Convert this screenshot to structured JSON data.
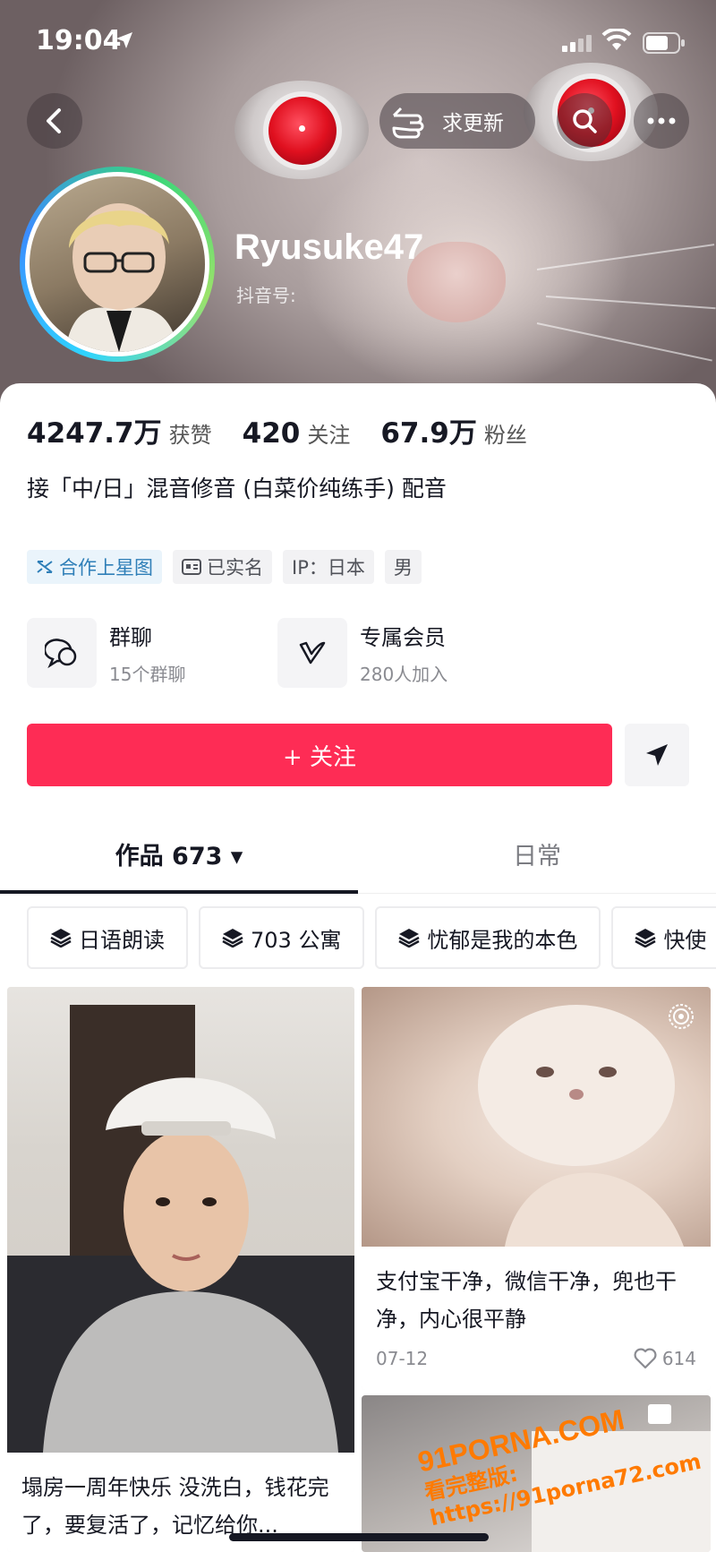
{
  "status_bar": {
    "time": "19:04"
  },
  "header": {
    "update_request_label": "求更新"
  },
  "profile": {
    "username": "Ryusuke47",
    "douyin_id_label": "抖音号:",
    "stats": [
      {
        "value": "4247.7万",
        "label": "获赞"
      },
      {
        "value": "420",
        "label": "关注"
      },
      {
        "value": "67.9万",
        "label": "粉丝"
      }
    ],
    "bio": "接「中/日」混音修音 (白菜价纯练手) 配音",
    "tags": [
      "合作上星图",
      "已实名",
      "IP：日本",
      "男"
    ]
  },
  "features": [
    {
      "title": "群聊",
      "subtitle": "15个群聊"
    },
    {
      "title": "专属会员",
      "subtitle": "280人加入"
    }
  ],
  "actions": {
    "follow_label": "+ 关注"
  },
  "tabs": [
    {
      "label": "作品 673 ▾"
    },
    {
      "label": "日常"
    }
  ],
  "collections": [
    "日语朗读",
    "703 公寓",
    "忧郁是我的本色",
    "快使"
  ],
  "videos": [
    {
      "caption": "塌房一周年快乐 没洗白，钱花完了，要复活了，记忆给你..."
    },
    {
      "caption": "支付宝干净，微信干净，兜也干净，内心很平静",
      "date": "07-12",
      "likes": "614"
    }
  ],
  "watermark": {
    "logo": "91PORNA.COM",
    "text": "看完整版: https://91porna72.com"
  },
  "colors": {
    "accent": "#fe2c55",
    "star_tag": "#2f7fb8"
  }
}
